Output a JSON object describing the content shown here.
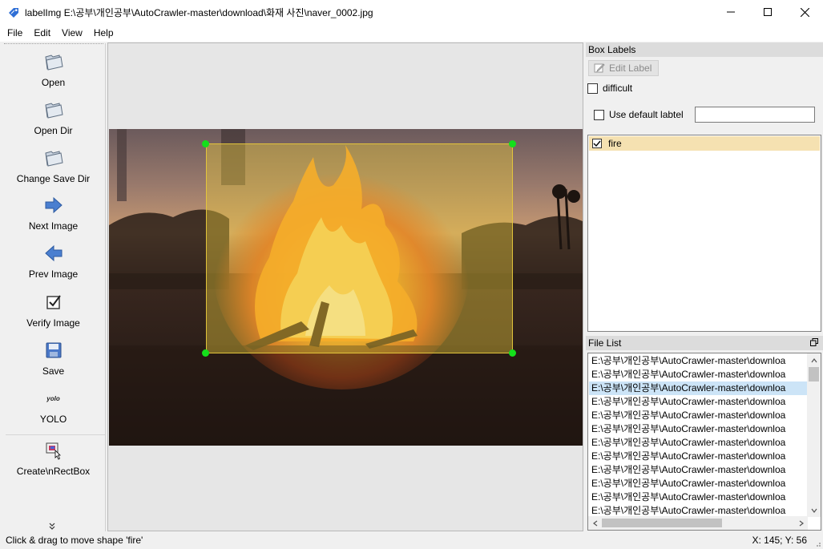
{
  "window": {
    "title": "labelImg E:\\공부\\개인공부\\AutoCrawler-master\\download\\화재 사진\\naver_0002.jpg",
    "minimize_icon": "minimize-icon",
    "maximize_icon": "maximize-icon",
    "close_icon": "close-icon"
  },
  "menu": {
    "items": [
      "File",
      "Edit",
      "View",
      "Help"
    ]
  },
  "toolbar": {
    "items": [
      {
        "label": "Open",
        "icon": "folder-open-icon"
      },
      {
        "label": "Open Dir",
        "icon": "folder-open-icon"
      },
      {
        "label": "Change Save Dir",
        "icon": "folder-open-icon"
      },
      {
        "label": "Next Image",
        "icon": "arrow-right-icon"
      },
      {
        "label": "Prev Image",
        "icon": "arrow-left-icon"
      },
      {
        "label": "Verify Image",
        "icon": "checkbox-icon"
      },
      {
        "label": "Save",
        "icon": "floppy-disk-icon"
      },
      {
        "label": "YOLO",
        "icon_text": "yolo"
      },
      {
        "label": "Create\\nRectBox",
        "icon": "create-rect-box-icon"
      }
    ]
  },
  "canvas": {
    "shape_label": "fire",
    "box_color": "#e6c83c",
    "handle_color": "#14e01b"
  },
  "box_labels": {
    "title": "Box Labels",
    "edit_label_button": "Edit Label",
    "difficult_label": "difficult",
    "difficult_checked": false,
    "use_default_label": "Use default labtel",
    "use_default_checked": false,
    "default_label_value": "",
    "labels": [
      {
        "text": "fire",
        "checked": true
      }
    ]
  },
  "file_list": {
    "title": "File List",
    "files": [
      "E:\\공부\\개인공부\\AutoCrawler-master\\downloa",
      "E:\\공부\\개인공부\\AutoCrawler-master\\downloa",
      "E:\\공부\\개인공부\\AutoCrawler-master\\downloa",
      "E:\\공부\\개인공부\\AutoCrawler-master\\downloa",
      "E:\\공부\\개인공부\\AutoCrawler-master\\downloa",
      "E:\\공부\\개인공부\\AutoCrawler-master\\downloa",
      "E:\\공부\\개인공부\\AutoCrawler-master\\downloa",
      "E:\\공부\\개인공부\\AutoCrawler-master\\downloa",
      "E:\\공부\\개인공부\\AutoCrawler-master\\downloa",
      "E:\\공부\\개인공부\\AutoCrawler-master\\downloa",
      "E:\\공부\\개인공부\\AutoCrawler-master\\downloa",
      "E:\\공부\\개인공부\\AutoCrawler-master\\downloa"
    ],
    "selected_index": 2
  },
  "status": {
    "message": "Click & drag to move shape 'fire'",
    "coordinates": "X: 145; Y: 56"
  }
}
